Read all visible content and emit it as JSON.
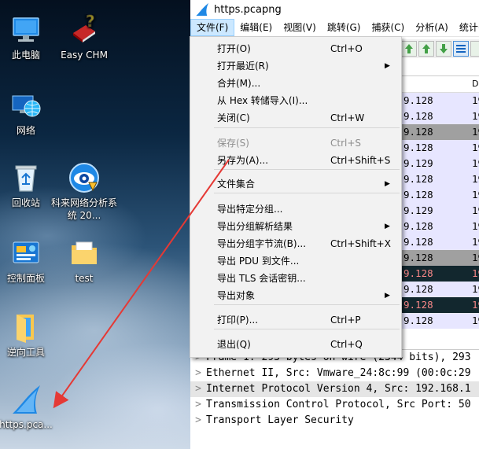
{
  "desktop": {
    "icons": [
      {
        "label": "此电脑",
        "icon": "computer-icon"
      },
      {
        "label": "Easy CHM",
        "icon": "help-book-icon"
      },
      {
        "label": "网络",
        "icon": "network-globe-icon"
      },
      {
        "label": "回收站",
        "icon": "recycle-bin-icon"
      },
      {
        "label": "科来网络分析系统 20...",
        "icon": "colasoft-eye-icon"
      },
      {
        "label": "控制面板",
        "icon": "control-panel-icon"
      },
      {
        "label": "test",
        "icon": "folder-icon"
      },
      {
        "label": "逆向工具",
        "icon": "folder-icon"
      },
      {
        "label": "https.pca...",
        "icon": "wireshark-fin-icon"
      }
    ]
  },
  "window": {
    "title": "https.pcapng",
    "title_icon": "wireshark-fin-icon",
    "menubar": [
      "文件(F)",
      "编辑(E)",
      "视图(V)",
      "跳转(G)",
      "捕获(C)",
      "分析(A)",
      "统计("
    ]
  },
  "file_menu": {
    "items": [
      {
        "label": "打开(O)",
        "shortcut": "Ctrl+O"
      },
      {
        "label": "打开最近(R)",
        "submenu": "▶"
      },
      {
        "label": "合并(M)..."
      },
      {
        "label": "从 Hex 转储导入(I)..."
      },
      {
        "label": "关闭(C)",
        "shortcut": "Ctrl+W"
      },
      {
        "label": "保存(S)",
        "shortcut": "Ctrl+S",
        "disabled": true
      },
      {
        "label": "另存为(A)...",
        "shortcut": "Ctrl+Shift+S"
      },
      {
        "label": "文件集合",
        "submenu": "▶"
      },
      {
        "label": "导出特定分组..."
      },
      {
        "label": "导出分组解析结果",
        "submenu": "▶"
      },
      {
        "label": "导出分组字节流(B)...",
        "shortcut": "Ctrl+Shift+X"
      },
      {
        "label": "导出 PDU 到文件..."
      },
      {
        "label": "导出 TLS 会话密钥..."
      },
      {
        "label": "导出对象",
        "submenu": "▶"
      },
      {
        "label": "打印(P)...",
        "shortcut": "Ctrl+P"
      },
      {
        "label": "退出(Q)",
        "shortcut": "Ctrl+Q"
      }
    ]
  },
  "packet_list": {
    "header": "De",
    "rows": [
      {
        "c1": "9.128",
        "c2": "19",
        "style": "normal"
      },
      {
        "c1": "9.128",
        "c2": "19",
        "style": "normal"
      },
      {
        "c1": "9.128",
        "c2": "19",
        "style": "gray"
      },
      {
        "c1": "9.128",
        "c2": "19",
        "style": "normal"
      },
      {
        "c1": "9.129",
        "c2": "19",
        "style": "normal"
      },
      {
        "c1": "9.128",
        "c2": "19",
        "style": "normal"
      },
      {
        "c1": "9.128",
        "c2": "19",
        "style": "normal"
      },
      {
        "c1": "9.129",
        "c2": "19",
        "style": "normal"
      },
      {
        "c1": "9.128",
        "c2": "19",
        "style": "normal"
      },
      {
        "c1": "9.128",
        "c2": "19",
        "style": "normal"
      },
      {
        "c1": "9.128",
        "c2": "19",
        "style": "gray"
      },
      {
        "c1": "9.128",
        "c2": "19",
        "style": "dark"
      },
      {
        "c1": "9.128",
        "c2": "19",
        "style": "normal"
      },
      {
        "c1": "9.128",
        "c2": "19",
        "style": "dark"
      },
      {
        "c1": "9.128",
        "c2": "19",
        "style": "normal"
      }
    ]
  },
  "details": {
    "rows": [
      {
        "text": "Frame 1: 293 bytes on wire (2344 bits), 293"
      },
      {
        "text": "Ethernet II, Src: Vmware_24:8c:99 (00:0c:29"
      },
      {
        "text": "Internet Protocol Version 4, Src: 192.168.1"
      },
      {
        "text": "Transmission Control Protocol, Src Port: 50"
      },
      {
        "text": "Transport Layer Security"
      }
    ],
    "expander": ">"
  },
  "colors": {
    "menu_highlight": "#cce8ff",
    "row_normal_bg": "#e7e6ff",
    "row_gray_bg": "#a0a0a0",
    "row_dark_bg": "#12272e",
    "row_dark_fg": "#f78787",
    "annotation_arrow": "#e53935"
  }
}
